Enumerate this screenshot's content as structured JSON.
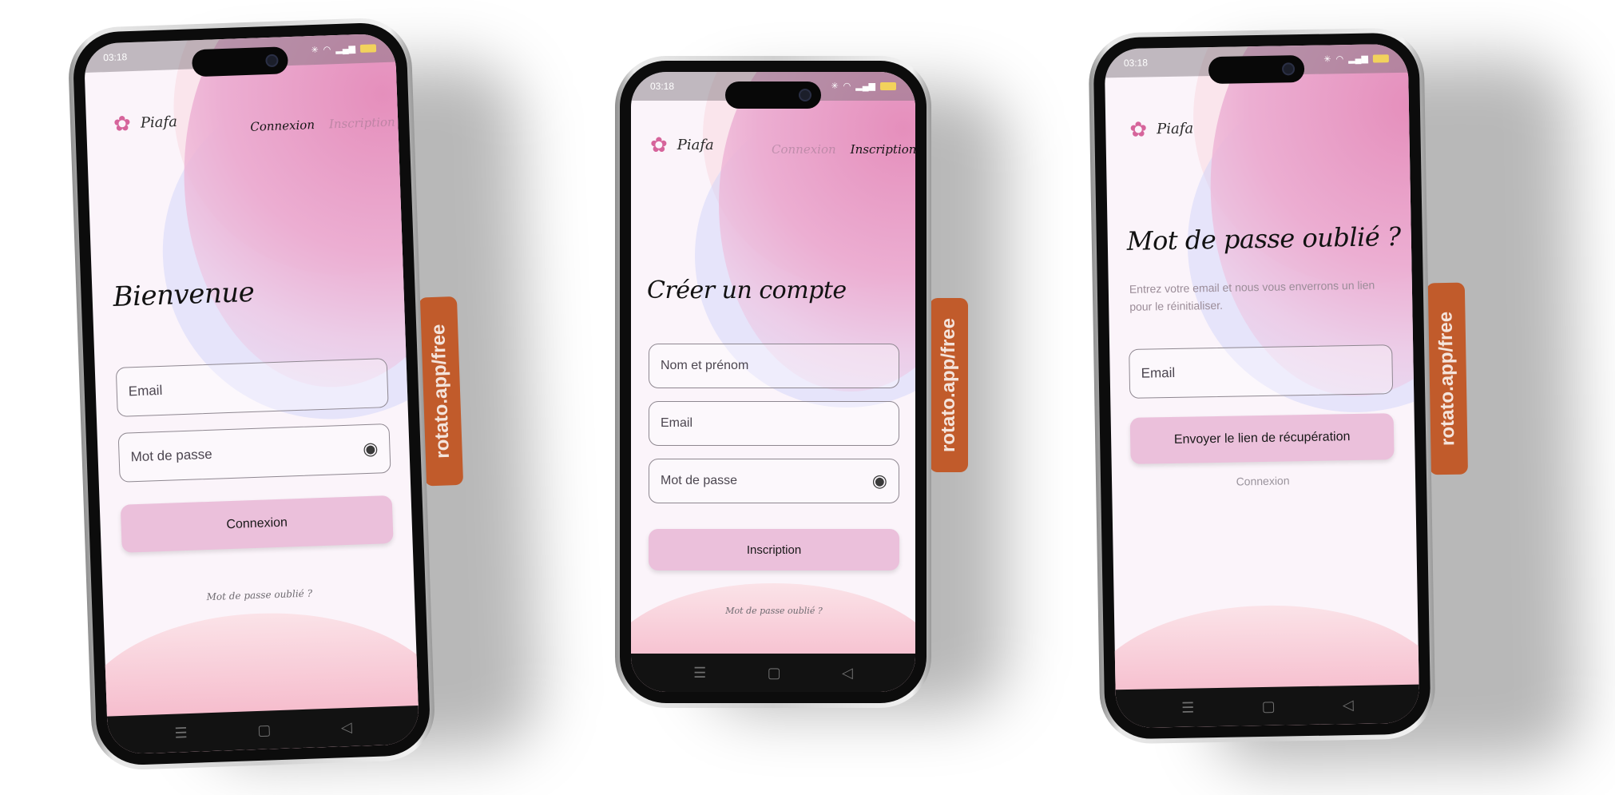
{
  "status": {
    "time": "03:18"
  },
  "brand": {
    "name": "Piafa"
  },
  "watermark": "rotato.app/free",
  "icons": {
    "logo": "piafa-flower-icon",
    "eye": "eye-off-icon",
    "nav_menu": "menu-icon",
    "nav_home": "home-icon",
    "nav_back": "back-icon"
  },
  "colors": {
    "accent": "#ebc0db",
    "tag": "#c15b2b"
  },
  "screens": {
    "login": {
      "tabs": {
        "connexion": "Connexion",
        "inscription": "Inscription"
      },
      "title": "Bienvenue",
      "email_placeholder": "Email",
      "password_placeholder": "Mot de passe",
      "submit": "Connexion",
      "forgot": "Mot de passe oublié ?"
    },
    "signup": {
      "tabs": {
        "connexion": "Connexion",
        "inscription": "Inscription"
      },
      "title": "Créer un compte",
      "name_placeholder": "Nom et prénom",
      "email_placeholder": "Email",
      "password_placeholder": "Mot de passe",
      "submit": "Inscription",
      "forgot": "Mot de passe oublié ?"
    },
    "forgot": {
      "title": "Mot de passe oublié ?",
      "subtitle": "Entrez votre email et nous vous enverrons un lien pour le réinitialiser.",
      "email_placeholder": "Email",
      "submit": "Envoyer le lien de récupération",
      "back_link": "Connexion"
    }
  }
}
